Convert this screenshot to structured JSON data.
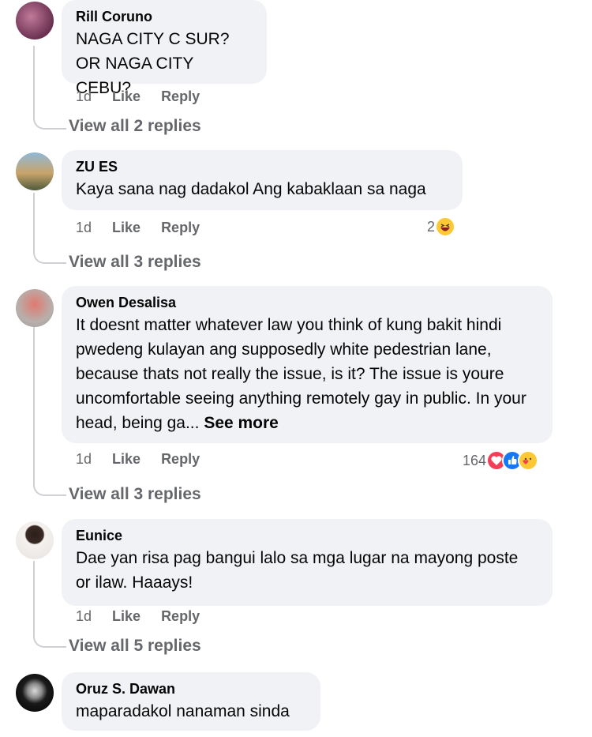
{
  "comments": [
    {
      "author": "Rill Coruno",
      "text": "NAGA CITY C SUR?\nOR NAGA CITY CEBU?",
      "time": "1d",
      "like": "Like",
      "reply": "Reply",
      "view_replies": "View all 2 replies"
    },
    {
      "author": "ZU ES",
      "text": "Kaya sana nag dadakol Ang kabaklaan sa naga",
      "time": "1d",
      "like": "Like",
      "reply": "Reply",
      "reactions": "2",
      "view_replies": "View all 3 replies"
    },
    {
      "author": "Owen Desalisa",
      "text": "It doesnt matter whatever law you think of kung bakit hindi pwedeng kulayan ang supposedly white pedestrian lane, because thats not really the issue, is it? The issue is youre uncomfortable seeing anything remotely gay in public. In your head, being ga...",
      "see_more": "See more",
      "time": "1d",
      "like": "Like",
      "reply": "Reply",
      "reactions": "164",
      "view_replies": "View all 3 replies"
    },
    {
      "author": "Eunice",
      "text": "Dae yan risa pag bangui lalo sa mga lugar na mayong poste or ilaw. Haaays!",
      "time": "1d",
      "like": "Like",
      "reply": "Reply",
      "view_replies": "View all 5 replies"
    },
    {
      "author": "Oruz S. Dawan",
      "text": "maparadakol nanaman sinda"
    }
  ],
  "icons": {
    "haha": "haha-emoji-icon",
    "love": "love-react-icon",
    "like": "like-react-icon",
    "care": "care-react-icon"
  },
  "colors": {
    "bubble": "#f0f2f5",
    "meta": "#65676b",
    "text": "#050505",
    "like_blue": "#1877f2",
    "love_red": "#f33e58",
    "haha_yellow": "#fcc934"
  }
}
